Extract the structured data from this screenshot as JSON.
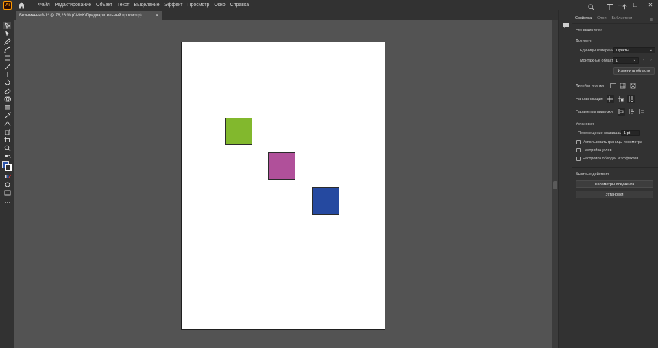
{
  "app": {
    "logo": "Ai"
  },
  "menu": [
    "Файл",
    "Редактирование",
    "Объект",
    "Текст",
    "Выделение",
    "Эффект",
    "Просмотр",
    "Окно",
    "Справка"
  ],
  "window_controls": {
    "minimize": "—",
    "maximize": "☐",
    "close": "✕"
  },
  "document_tab": {
    "title": "Безымянный-1* @ 78,26 % (CMYK/Предварительный просмотр)",
    "close": "✕"
  },
  "artboard": {
    "shapes": [
      {
        "name": "green-square",
        "color": "#82b82d"
      },
      {
        "name": "magenta-square",
        "color": "#b0509a"
      },
      {
        "name": "blue-square",
        "color": "#2549a0"
      }
    ]
  },
  "colors": {
    "fill": "#2a52a7",
    "stroke": "#ffffff",
    "accent": "#ff9a00"
  },
  "panel": {
    "tabs": [
      "Свойства",
      "Слои",
      "Библиотеки"
    ],
    "more": "≡",
    "no_selection": "Нет выделения",
    "document_heading": "Документ",
    "units_label": "Единицы измерения:",
    "units_value": "Пункты",
    "artboards_label": "Монтажные области:",
    "artboards_value": "1",
    "edit_artboards": "Изменить области",
    "rulers_grids": "Линейки и сетки",
    "guides": "Направляющие",
    "snap_options": "Параметры привязки",
    "preferences_heading": "Установки",
    "keyboard_increment_label": "Перемещение клавишами:",
    "keyboard_increment_value": "1 pt",
    "check_preview_bounds": "Использовать границы просмотра",
    "check_scale_corners": "Настройка углов",
    "check_scale_strokes": "Настройка обводки и эффектов",
    "quick_actions": "Быстрые действия",
    "document_setup": "Параметры документа",
    "preferences_button": "Установки"
  }
}
